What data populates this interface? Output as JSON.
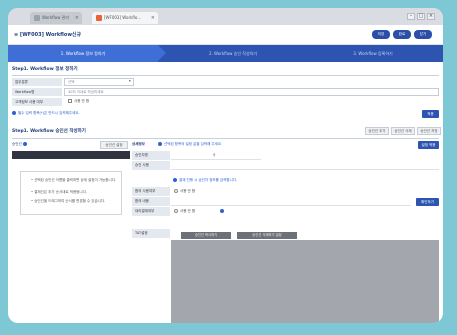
{
  "browser": {
    "tabs": [
      {
        "label": "Workflow 관리"
      },
      {
        "label": "[WF003] Workflo..."
      }
    ],
    "tab_close": "×",
    "window_buttons": [
      "–",
      "□",
      "×"
    ]
  },
  "header": {
    "title": "≡ [WF003] Workflow신규",
    "buttons": [
      "저장",
      "완료",
      "닫기"
    ]
  },
  "steps": [
    "1. Workflow 정보 정하기",
    "2. Workflow 승인 작성하기",
    "3. Workflow 등록하기"
  ],
  "step1": {
    "heading": "Step1. Workflow 정보 정하기",
    "fields": [
      {
        "label": "업무분류",
        "value": "선택"
      },
      {
        "label": "Workflow명",
        "placeholder": "40자 이내로 작성하세요"
      },
      {
        "label": "고객정보 사용 여부",
        "value": "사용 안 함"
      }
    ],
    "note": "필수 입력 항목(*)은 반드시 입력해주세요.",
    "save_button": "적용"
  },
  "step2": {
    "heading": "Step1. Workflow 승인선 작성하기",
    "toolbar": [
      "승인선 추가",
      "승인선 삭제",
      "승인선 저장"
    ],
    "left_label": "승인선",
    "left_btn": "승인선 설정",
    "right_label": "상세정보",
    "right_note": "선택된 항목의 설정 값을 입력해 주세요",
    "right_btn": "설정 적용",
    "bullets": [
      "선택된 승인선 이름을 클릭하면 상세 설정이 가능합니다.",
      "결재선은 추가 순서대로 적용됩니다.",
      "승인선을 드래그하여 순서를 변경할 수 있습니다."
    ],
    "rows": [
      {
        "label": "승인자명",
        "value": ""
      },
      {
        "label": "승인 사용",
        "value": "결재 진행 시 승인자 정보를 입력합니다."
      },
      {
        "label": "합의 사용여부",
        "value": "사용  안 함"
      },
      {
        "label": "합의 내용",
        "value": ""
      },
      {
        "label": "대리결재여부",
        "value": "사용  안 함"
      },
      {
        "label": "TAT설정",
        "value": ""
      }
    ],
    "row_side_btn": "확인하기",
    "gray_buttons": [
      "승인선 복사하기",
      "승인선 삭제하기 설정"
    ]
  }
}
